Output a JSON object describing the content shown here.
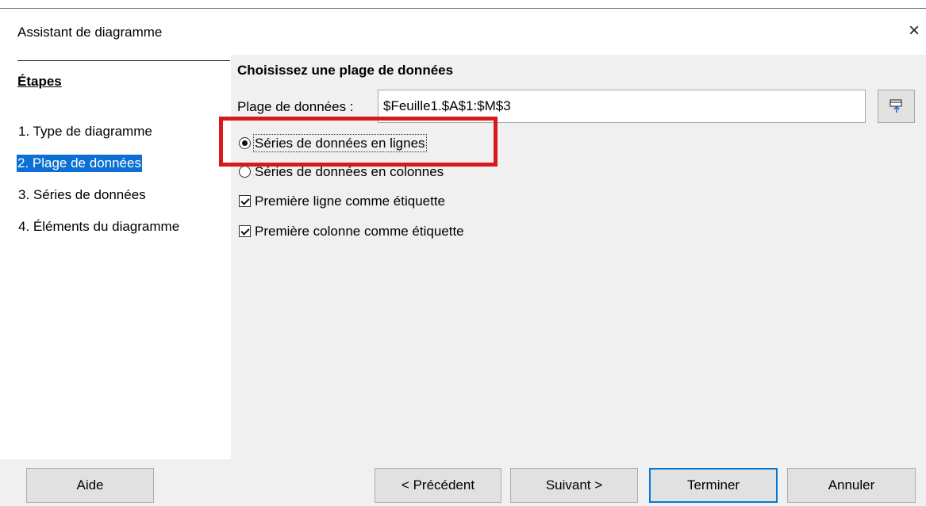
{
  "window": {
    "title": "Assistant de diagramme",
    "close_glyph": "×"
  },
  "sidebar": {
    "heading": "Étapes",
    "steps": [
      {
        "label": "1. Type de diagramme"
      },
      {
        "label": "2. Plage de données",
        "selected": true
      },
      {
        "label": "3. Séries de données"
      },
      {
        "label": "4. Éléments du diagramme"
      }
    ]
  },
  "main": {
    "title": "Choisissez une plage de données",
    "range_label": "Plage de données :",
    "range_value": "$Feuille1.$A$1:$M$3",
    "options": {
      "rows": {
        "label": "Séries de données en lignes",
        "checked": true
      },
      "columns": {
        "label": "Séries de données en colonnes",
        "checked": false
      },
      "first_row": {
        "label": "Première ligne comme étiquette",
        "checked": true
      },
      "first_col": {
        "label": "Première colonne comme étiquette",
        "checked": true
      }
    }
  },
  "footer": {
    "help": "Aide",
    "prev": "< Précédent",
    "next": "Suivant >",
    "finish": "Terminer",
    "cancel": "Annuler"
  },
  "colors": {
    "selection": "#0b6fd3",
    "annotation": "#d7191d",
    "default_button_border": "#0078d7"
  }
}
